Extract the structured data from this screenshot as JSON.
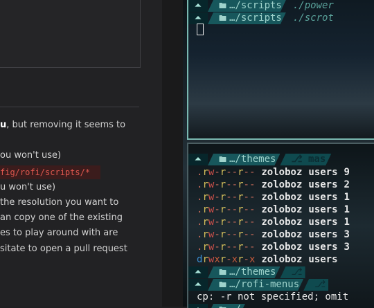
{
  "doc": {
    "line1_bold": "u",
    "line1_rest": ", but removing it seems to",
    "line2": "ou won't use)",
    "code": "fig/rofi/scripts/*",
    "line3": "u won't use)",
    "line4": " the resolution you want to",
    "line5": "an copy one of the existing",
    "line6": "es to play around with are",
    "line7": "sitate to open a pull request"
  },
  "top_terminal": {
    "prompt1": {
      "arrow": "⏶",
      "path": "…/scripts",
      "cmd": "./power"
    },
    "prompt2": {
      "arrow": "⏶",
      "path": "…/scripts",
      "cmd": "./scrot"
    }
  },
  "bottom_terminal": {
    "prompt_themes": {
      "arrow": "⏶",
      "path": "…/themes",
      "git": "mas"
    },
    "ls": [
      {
        "perm": ".rw-r--r--",
        "owner": "zoloboz",
        "group": "users",
        "size": "9"
      },
      {
        "perm": ".rw-r--r--",
        "owner": "zoloboz",
        "group": "users",
        "size": "2"
      },
      {
        "perm": ".rw-r--r--",
        "owner": "zoloboz",
        "group": "users",
        "size": "1"
      },
      {
        "perm": ".rw-r--r--",
        "owner": "zoloboz",
        "group": "users",
        "size": "1"
      },
      {
        "perm": ".rw-r--r--",
        "owner": "zoloboz",
        "group": "users",
        "size": "1"
      },
      {
        "perm": ".rw-r--r--",
        "owner": "zoloboz",
        "group": "users",
        "size": "3"
      },
      {
        "perm": ".rw-r--r--",
        "owner": "zoloboz",
        "group": "users",
        "size": "3"
      },
      {
        "perm": "drwxr-xr-x",
        "owner": "zoloboz",
        "group": "users",
        "size": ""
      }
    ],
    "prompt_themes2": {
      "arrow": "⏶",
      "path": "…/themes",
      "git": "⎇"
    },
    "prompt_rofi": {
      "arrow": "⏶",
      "path": "…/rofi-menus",
      "git": "⎇"
    },
    "error": "cp: -r not specified; omit",
    "last_path": "…/"
  },
  "colors": {
    "accent": "#7ab8b0",
    "path_bg": "#17575c",
    "git_bg": "#0f4a4f"
  }
}
